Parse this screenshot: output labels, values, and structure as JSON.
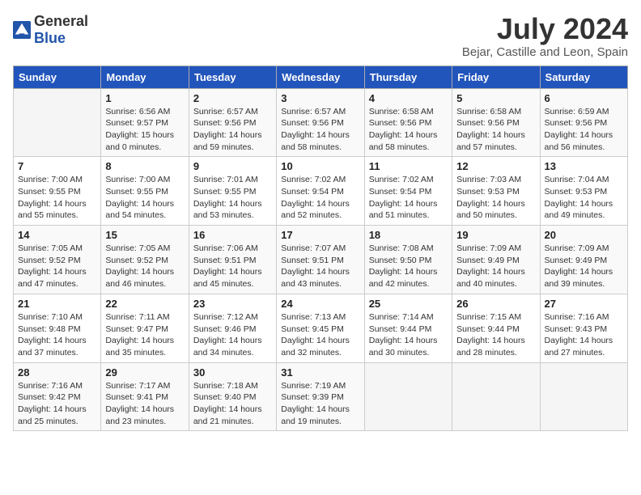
{
  "header": {
    "logo_general": "General",
    "logo_blue": "Blue",
    "title": "July 2024",
    "subtitle": "Bejar, Castille and Leon, Spain"
  },
  "columns": [
    "Sunday",
    "Monday",
    "Tuesday",
    "Wednesday",
    "Thursday",
    "Friday",
    "Saturday"
  ],
  "weeks": [
    [
      {
        "day": "",
        "lines": []
      },
      {
        "day": "1",
        "lines": [
          "Sunrise: 6:56 AM",
          "Sunset: 9:57 PM",
          "Daylight: 15 hours",
          "and 0 minutes."
        ]
      },
      {
        "day": "2",
        "lines": [
          "Sunrise: 6:57 AM",
          "Sunset: 9:56 PM",
          "Daylight: 14 hours",
          "and 59 minutes."
        ]
      },
      {
        "day": "3",
        "lines": [
          "Sunrise: 6:57 AM",
          "Sunset: 9:56 PM",
          "Daylight: 14 hours",
          "and 58 minutes."
        ]
      },
      {
        "day": "4",
        "lines": [
          "Sunrise: 6:58 AM",
          "Sunset: 9:56 PM",
          "Daylight: 14 hours",
          "and 58 minutes."
        ]
      },
      {
        "day": "5",
        "lines": [
          "Sunrise: 6:58 AM",
          "Sunset: 9:56 PM",
          "Daylight: 14 hours",
          "and 57 minutes."
        ]
      },
      {
        "day": "6",
        "lines": [
          "Sunrise: 6:59 AM",
          "Sunset: 9:56 PM",
          "Daylight: 14 hours",
          "and 56 minutes."
        ]
      }
    ],
    [
      {
        "day": "7",
        "lines": [
          "Sunrise: 7:00 AM",
          "Sunset: 9:55 PM",
          "Daylight: 14 hours",
          "and 55 minutes."
        ]
      },
      {
        "day": "8",
        "lines": [
          "Sunrise: 7:00 AM",
          "Sunset: 9:55 PM",
          "Daylight: 14 hours",
          "and 54 minutes."
        ]
      },
      {
        "day": "9",
        "lines": [
          "Sunrise: 7:01 AM",
          "Sunset: 9:55 PM",
          "Daylight: 14 hours",
          "and 53 minutes."
        ]
      },
      {
        "day": "10",
        "lines": [
          "Sunrise: 7:02 AM",
          "Sunset: 9:54 PM",
          "Daylight: 14 hours",
          "and 52 minutes."
        ]
      },
      {
        "day": "11",
        "lines": [
          "Sunrise: 7:02 AM",
          "Sunset: 9:54 PM",
          "Daylight: 14 hours",
          "and 51 minutes."
        ]
      },
      {
        "day": "12",
        "lines": [
          "Sunrise: 7:03 AM",
          "Sunset: 9:53 PM",
          "Daylight: 14 hours",
          "and 50 minutes."
        ]
      },
      {
        "day": "13",
        "lines": [
          "Sunrise: 7:04 AM",
          "Sunset: 9:53 PM",
          "Daylight: 14 hours",
          "and 49 minutes."
        ]
      }
    ],
    [
      {
        "day": "14",
        "lines": [
          "Sunrise: 7:05 AM",
          "Sunset: 9:52 PM",
          "Daylight: 14 hours",
          "and 47 minutes."
        ]
      },
      {
        "day": "15",
        "lines": [
          "Sunrise: 7:05 AM",
          "Sunset: 9:52 PM",
          "Daylight: 14 hours",
          "and 46 minutes."
        ]
      },
      {
        "day": "16",
        "lines": [
          "Sunrise: 7:06 AM",
          "Sunset: 9:51 PM",
          "Daylight: 14 hours",
          "and 45 minutes."
        ]
      },
      {
        "day": "17",
        "lines": [
          "Sunrise: 7:07 AM",
          "Sunset: 9:51 PM",
          "Daylight: 14 hours",
          "and 43 minutes."
        ]
      },
      {
        "day": "18",
        "lines": [
          "Sunrise: 7:08 AM",
          "Sunset: 9:50 PM",
          "Daylight: 14 hours",
          "and 42 minutes."
        ]
      },
      {
        "day": "19",
        "lines": [
          "Sunrise: 7:09 AM",
          "Sunset: 9:49 PM",
          "Daylight: 14 hours",
          "and 40 minutes."
        ]
      },
      {
        "day": "20",
        "lines": [
          "Sunrise: 7:09 AM",
          "Sunset: 9:49 PM",
          "Daylight: 14 hours",
          "and 39 minutes."
        ]
      }
    ],
    [
      {
        "day": "21",
        "lines": [
          "Sunrise: 7:10 AM",
          "Sunset: 9:48 PM",
          "Daylight: 14 hours",
          "and 37 minutes."
        ]
      },
      {
        "day": "22",
        "lines": [
          "Sunrise: 7:11 AM",
          "Sunset: 9:47 PM",
          "Daylight: 14 hours",
          "and 35 minutes."
        ]
      },
      {
        "day": "23",
        "lines": [
          "Sunrise: 7:12 AM",
          "Sunset: 9:46 PM",
          "Daylight: 14 hours",
          "and 34 minutes."
        ]
      },
      {
        "day": "24",
        "lines": [
          "Sunrise: 7:13 AM",
          "Sunset: 9:45 PM",
          "Daylight: 14 hours",
          "and 32 minutes."
        ]
      },
      {
        "day": "25",
        "lines": [
          "Sunrise: 7:14 AM",
          "Sunset: 9:44 PM",
          "Daylight: 14 hours",
          "and 30 minutes."
        ]
      },
      {
        "day": "26",
        "lines": [
          "Sunrise: 7:15 AM",
          "Sunset: 9:44 PM",
          "Daylight: 14 hours",
          "and 28 minutes."
        ]
      },
      {
        "day": "27",
        "lines": [
          "Sunrise: 7:16 AM",
          "Sunset: 9:43 PM",
          "Daylight: 14 hours",
          "and 27 minutes."
        ]
      }
    ],
    [
      {
        "day": "28",
        "lines": [
          "Sunrise: 7:16 AM",
          "Sunset: 9:42 PM",
          "Daylight: 14 hours",
          "and 25 minutes."
        ]
      },
      {
        "day": "29",
        "lines": [
          "Sunrise: 7:17 AM",
          "Sunset: 9:41 PM",
          "Daylight: 14 hours",
          "and 23 minutes."
        ]
      },
      {
        "day": "30",
        "lines": [
          "Sunrise: 7:18 AM",
          "Sunset: 9:40 PM",
          "Daylight: 14 hours",
          "and 21 minutes."
        ]
      },
      {
        "day": "31",
        "lines": [
          "Sunrise: 7:19 AM",
          "Sunset: 9:39 PM",
          "Daylight: 14 hours",
          "and 19 minutes."
        ]
      },
      {
        "day": "",
        "lines": []
      },
      {
        "day": "",
        "lines": []
      },
      {
        "day": "",
        "lines": []
      }
    ]
  ]
}
